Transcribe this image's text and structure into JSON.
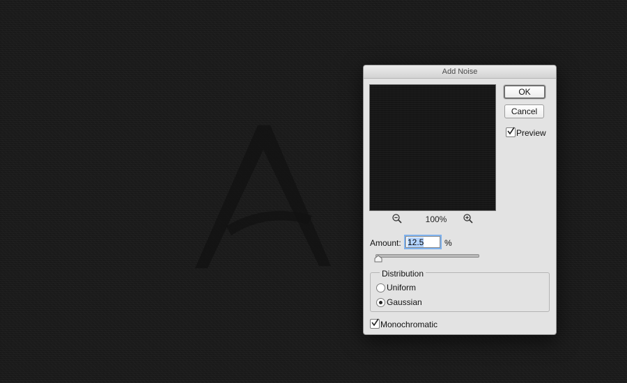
{
  "dialog": {
    "title": "Add Noise",
    "zoom_level": "100%",
    "ok_label": "OK",
    "cancel_label": "Cancel",
    "preview_label": "Preview",
    "preview_checked": true,
    "amount_label": "Amount:",
    "amount_value": "12.5",
    "amount_unit": "%",
    "distribution": {
      "title": "Distribution",
      "options": [
        "Uniform",
        "Gaussian"
      ],
      "selected": "Gaussian"
    },
    "monochromatic_label": "Monochromatic",
    "monochromatic_checked": true
  },
  "icons": {
    "zoom_out": "zoom-out-icon",
    "zoom_in": "zoom-in-icon",
    "checkmark": "checkmark-icon",
    "slider_thumb": "slider-thumb-icon",
    "canvas_glyph": "letter-a-logo"
  },
  "colors": {
    "canvas_bg": "#1c1c1c",
    "dialog_bg": "#e3e3e3",
    "focus_ring": "#7fb2ee",
    "selection": "#b3d3ff"
  }
}
